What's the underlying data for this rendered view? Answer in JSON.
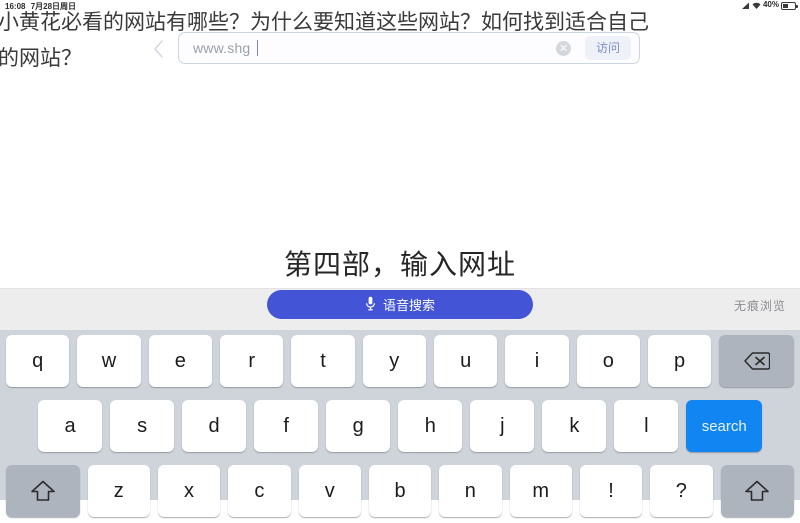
{
  "status_bar": {
    "time": "16:08",
    "date": "7月28日周日",
    "battery_percent": "40%",
    "signal_icon": "signal-icon",
    "battery_icon": "battery-icon"
  },
  "browser": {
    "back_icon": "back-chevron-icon",
    "url_value": "www.shg",
    "url_placeholder": "www.shg",
    "clear_icon": "clear-circle-icon",
    "clear_glyph": "✕",
    "visit_label": "访问"
  },
  "caption": {
    "line_1": "小黄花必看的网站有哪些？为什么要知道这些网站？如何找到适合自己",
    "line_2": "的网站？"
  },
  "section": {
    "title": "第四部，输入网址"
  },
  "keyboard_toolbar": {
    "voice_search_label": "语音搜索",
    "mic_icon": "microphone-icon",
    "incognito_label": "无痕浏览"
  },
  "keyboard": {
    "row_1": [
      {
        "label": "q",
        "name": "key-q",
        "type": "letter"
      },
      {
        "label": "w",
        "name": "key-w",
        "type": "letter"
      },
      {
        "label": "e",
        "name": "key-e",
        "type": "letter"
      },
      {
        "label": "r",
        "name": "key-r",
        "type": "letter"
      },
      {
        "label": "t",
        "name": "key-t",
        "type": "letter"
      },
      {
        "label": "y",
        "name": "key-y",
        "type": "letter"
      },
      {
        "label": "u",
        "name": "key-u",
        "type": "letter"
      },
      {
        "label": "i",
        "name": "key-i",
        "type": "letter"
      },
      {
        "label": "o",
        "name": "key-o",
        "type": "letter"
      },
      {
        "label": "p",
        "name": "key-p",
        "type": "letter"
      },
      {
        "label": "",
        "name": "key-backspace",
        "type": "backspace",
        "icon": "backspace-icon"
      }
    ],
    "row_2": [
      {
        "label": "a",
        "name": "key-a",
        "type": "letter"
      },
      {
        "label": "s",
        "name": "key-s",
        "type": "letter"
      },
      {
        "label": "d",
        "name": "key-d",
        "type": "letter"
      },
      {
        "label": "f",
        "name": "key-f",
        "type": "letter"
      },
      {
        "label": "g",
        "name": "key-g",
        "type": "letter"
      },
      {
        "label": "h",
        "name": "key-h",
        "type": "letter"
      },
      {
        "label": "j",
        "name": "key-j",
        "type": "letter"
      },
      {
        "label": "k",
        "name": "key-k",
        "type": "letter"
      },
      {
        "label": "l",
        "name": "key-l",
        "type": "letter"
      },
      {
        "label": "search",
        "name": "key-search",
        "type": "action"
      }
    ],
    "row_3": [
      {
        "label": "",
        "name": "key-shift-left",
        "type": "shift",
        "icon": "shift-up-arrow-icon"
      },
      {
        "label": "z",
        "name": "key-z",
        "type": "letter"
      },
      {
        "label": "x",
        "name": "key-x",
        "type": "letter"
      },
      {
        "label": "c",
        "name": "key-c",
        "type": "letter"
      },
      {
        "label": "v",
        "name": "key-v",
        "type": "letter"
      },
      {
        "label": "b",
        "name": "key-b",
        "type": "letter"
      },
      {
        "label": "n",
        "name": "key-n",
        "type": "letter"
      },
      {
        "label": "m",
        "name": "key-m",
        "type": "letter"
      },
      {
        "label": "!",
        "name": "key-exclamation",
        "type": "letter"
      },
      {
        "label": "?",
        "name": "key-question",
        "type": "letter"
      },
      {
        "label": "",
        "name": "key-shift-right",
        "type": "shift",
        "icon": "shift-up-arrow-icon"
      }
    ]
  },
  "colors": {
    "accent_blue": "#1186f2",
    "voice_blue": "#4355d6",
    "keyboard_bg": "#cfd3da",
    "key_white": "#ffffff",
    "key_fn_gray": "#aeb4be",
    "toolbar_bg": "#ededee"
  }
}
